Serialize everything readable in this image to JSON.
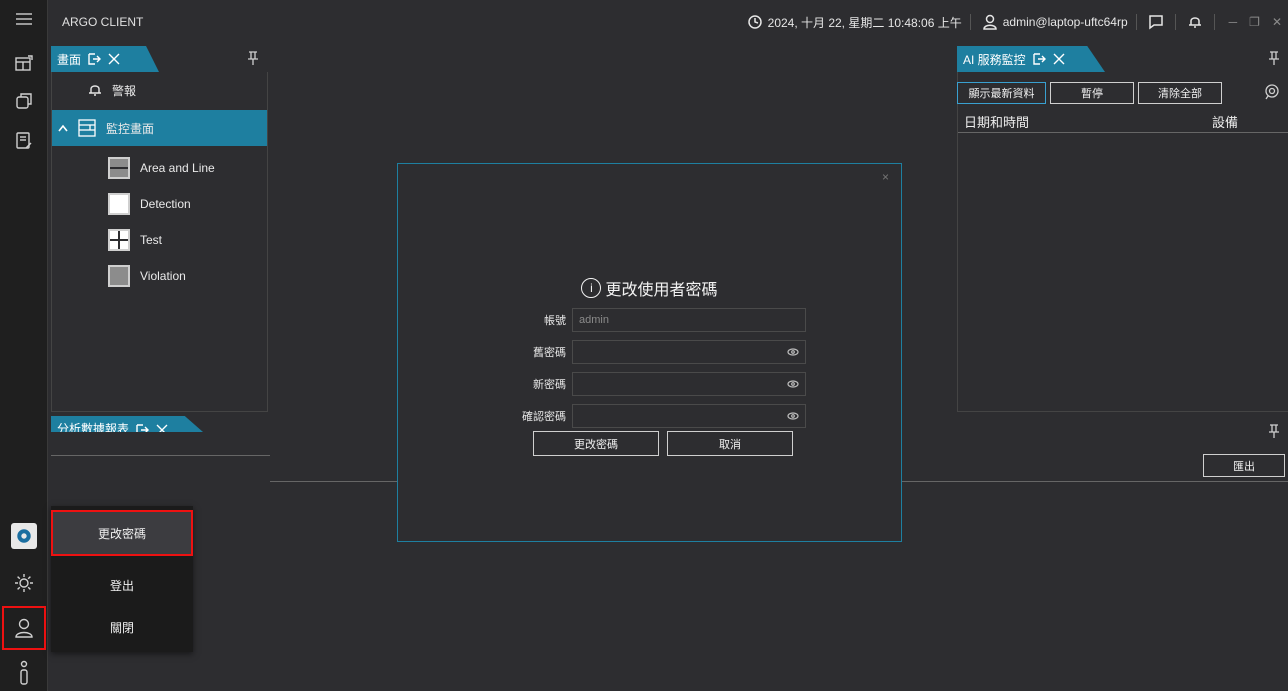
{
  "titlebar": {
    "app_title": "ARGO CLIENT",
    "datetime": "2024, 十月 22, 星期二 10:48:06 上午",
    "user": "admin@laptop-uftc64rp"
  },
  "left_panel": {
    "tab_label": "畫面",
    "tree": [
      {
        "label": "警報"
      },
      {
        "label": "監控畫面"
      },
      {
        "label": "Area and Line"
      },
      {
        "label": "Detection"
      },
      {
        "label": "Test"
      },
      {
        "label": "Violation"
      }
    ],
    "bottom_tab_label": "分析數據報表"
  },
  "right_panel": {
    "tab_label": "AI 服務監控",
    "buttons": {
      "show_latest": "顯示最新資料",
      "pause": "暫停",
      "clear_all": "清除全部"
    },
    "columns": [
      "日期和時間",
      "設備"
    ],
    "export_label": "匯出"
  },
  "modal": {
    "title": "更改使用者密碼",
    "fields": {
      "account_label": "帳號",
      "account_value": "admin",
      "old_pw_label": "舊密碼",
      "new_pw_label": "新密碼",
      "confirm_pw_label": "確認密碼"
    },
    "buttons": {
      "submit": "更改密碼",
      "cancel": "取消"
    },
    "close_glyph": "×"
  },
  "user_menu": {
    "items": [
      "更改密碼",
      "登出",
      "關閉"
    ]
  },
  "colors": {
    "accent": "#1e7fa0",
    "highlight": "#e11111"
  }
}
